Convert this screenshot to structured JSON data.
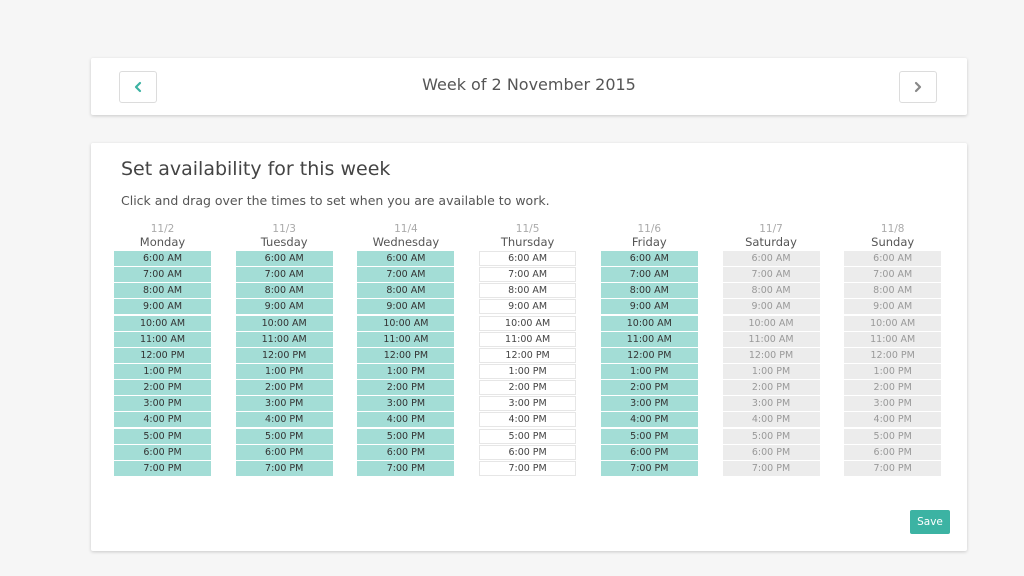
{
  "week_nav": {
    "title": "Week of 2 November 2015"
  },
  "availability": {
    "title": "Set availability for this week",
    "instructions": "Click and drag over the times to set when you are available to work.",
    "save_label": "Save",
    "colors": {
      "available": "#a3ddd6",
      "disabled": "#ececec",
      "save": "#3cb3a3"
    },
    "times": [
      "6:00 AM",
      "7:00 AM",
      "8:00 AM",
      "9:00 AM",
      "10:00 AM",
      "11:00 AM",
      "12:00 PM",
      "1:00 PM",
      "2:00 PM",
      "3:00 PM",
      "4:00 PM",
      "5:00 PM",
      "6:00 PM",
      "7:00 PM"
    ],
    "days": [
      {
        "date": "11/2",
        "name": "Monday",
        "state": "available"
      },
      {
        "date": "11/3",
        "name": "Tuesday",
        "state": "available"
      },
      {
        "date": "11/4",
        "name": "Wednesday",
        "state": "available"
      },
      {
        "date": "11/5",
        "name": "Thursday",
        "state": "unavailable"
      },
      {
        "date": "11/6",
        "name": "Friday",
        "state": "available"
      },
      {
        "date": "11/7",
        "name": "Saturday",
        "state": "disabled"
      },
      {
        "date": "11/8",
        "name": "Sunday",
        "state": "disabled"
      }
    ]
  }
}
